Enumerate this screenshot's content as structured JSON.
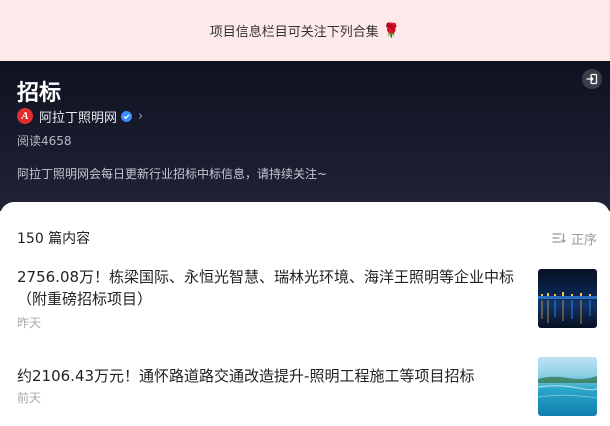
{
  "banner": {
    "text": "项目信息栏目可关注下列合集",
    "emoji": "🌹"
  },
  "hero": {
    "title": "招标",
    "author": {
      "avatar_letter": "A",
      "name": "阿拉丁照明网"
    },
    "read_count": "阅读4658",
    "description": "阿拉丁照明网会每日更新行业招标中标信息，请持续关注~"
  },
  "list": {
    "count_label": "150 篇内容",
    "sort_label": "正序",
    "articles": [
      {
        "title": "2756.08万！栋梁国际、永恒光智慧、瑞林光环境、海洋王照明等企业中标（附重磅招标项目）",
        "time": "昨天"
      },
      {
        "title": "约2106.43万元！通怀路道路交通改造提升-照明工程施工等项目招标",
        "time": "前天"
      }
    ]
  },
  "icons": {
    "exit": "exit-icon",
    "verified": "verified-badge-icon",
    "chevron": "chevron-right-icon",
    "sort": "sort-icon"
  },
  "colors": {
    "banner_bg": "#fde9ea",
    "hero_bg": "#151828",
    "brand_red": "#e12d2d",
    "verified_blue": "#3a8cff"
  }
}
